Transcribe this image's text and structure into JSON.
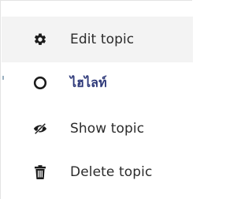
{
  "menu": {
    "items": [
      {
        "label": "Edit topic",
        "icon": "gear-icon"
      },
      {
        "label": "ไฮไลท์",
        "icon": "circle-icon"
      },
      {
        "label": "Show topic",
        "icon": "eye-slash-icon"
      },
      {
        "label": "Delete topic",
        "icon": "trash-icon"
      }
    ]
  },
  "colors": {
    "hover_bg": "#f3f3f3",
    "text": "#2b2b2b",
    "thai_text": "#2f3a7a",
    "icon": "#1c1c1c"
  }
}
